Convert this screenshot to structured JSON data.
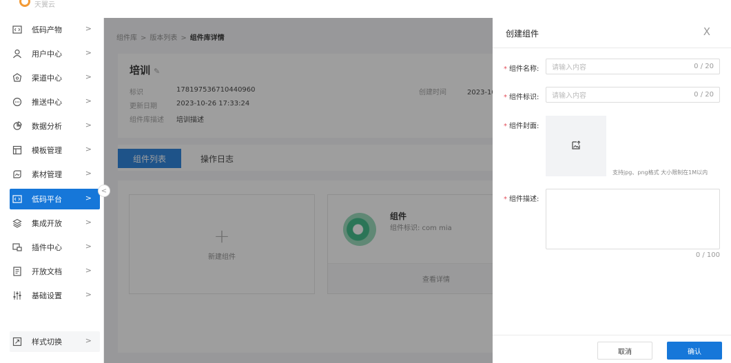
{
  "brand": {
    "name": "天翼云"
  },
  "sidebar": {
    "items": [
      {
        "label": "低码产物",
        "icon": "code-box-icon",
        "arrow": ">"
      },
      {
        "label": "用户中心",
        "icon": "user-icon",
        "arrow": ">"
      },
      {
        "label": "渠道中心",
        "icon": "channel-icon",
        "arrow": ">"
      },
      {
        "label": "推送中心",
        "icon": "message-icon",
        "arrow": ">"
      },
      {
        "label": "数据分析",
        "icon": "pie-chart-icon",
        "arrow": ">"
      },
      {
        "label": "模板管理",
        "icon": "template-icon",
        "arrow": ">"
      },
      {
        "label": "素材管理",
        "icon": "material-icon",
        "arrow": ">"
      },
      {
        "label": "低码平台",
        "icon": "code-box-icon",
        "arrow": ">",
        "active": true
      },
      {
        "label": "集成开放",
        "icon": "layers-icon",
        "arrow": ">"
      },
      {
        "label": "插件中心",
        "icon": "plugin-icon",
        "arrow": ">"
      },
      {
        "label": "开放文档",
        "icon": "document-icon",
        "arrow": ">"
      },
      {
        "label": "基础设置",
        "icon": "settings-sliders-icon",
        "arrow": ">"
      }
    ],
    "bottom_item": {
      "label": "样式切换",
      "icon": "style-switch-icon",
      "arrow": ">"
    },
    "collapse_glyph": "<"
  },
  "breadcrumb": {
    "items": [
      "组件库",
      "版本列表",
      "组件库详情"
    ],
    "separator": ">"
  },
  "library": {
    "title": "培训",
    "edit_glyph": "✎",
    "id_label": "标识",
    "id_value": "178197536710440960",
    "updated_label": "更新日期",
    "updated_value": "2023-10-26 17:33:24",
    "desc_label": "组件库描述",
    "desc_value": "培训描述",
    "created_label": "创建时间",
    "created_value": "2023-10-"
  },
  "tabs": {
    "active": "组件列表",
    "inactive": "操作日志"
  },
  "cards": {
    "new_card": {
      "plus": "+",
      "label": "新建组件"
    },
    "component": {
      "name": "组件",
      "id_line": "组件标识: com mia",
      "detail_link": "查看详情"
    }
  },
  "drawer": {
    "title": "创建组件",
    "close": "X",
    "required_mark": "*",
    "name_field": {
      "label": "组件名称:",
      "placeholder": "请输入内容",
      "count": "0 / 20"
    },
    "key_field": {
      "label": "组件标识:",
      "placeholder": "请输入内容",
      "count": "0 / 20"
    },
    "cover_field": {
      "label": "组件封面:",
      "hint": "支持jpg、png格式 大小限制在1M以内"
    },
    "desc_field": {
      "label": "组件描述:",
      "count": "0 / 100"
    },
    "cancel": "取消",
    "confirm": "确认"
  },
  "colors": {
    "primary": "#1677d9",
    "required": "#e34d59",
    "overlay": "rgba(40,40,40,0.45)"
  }
}
